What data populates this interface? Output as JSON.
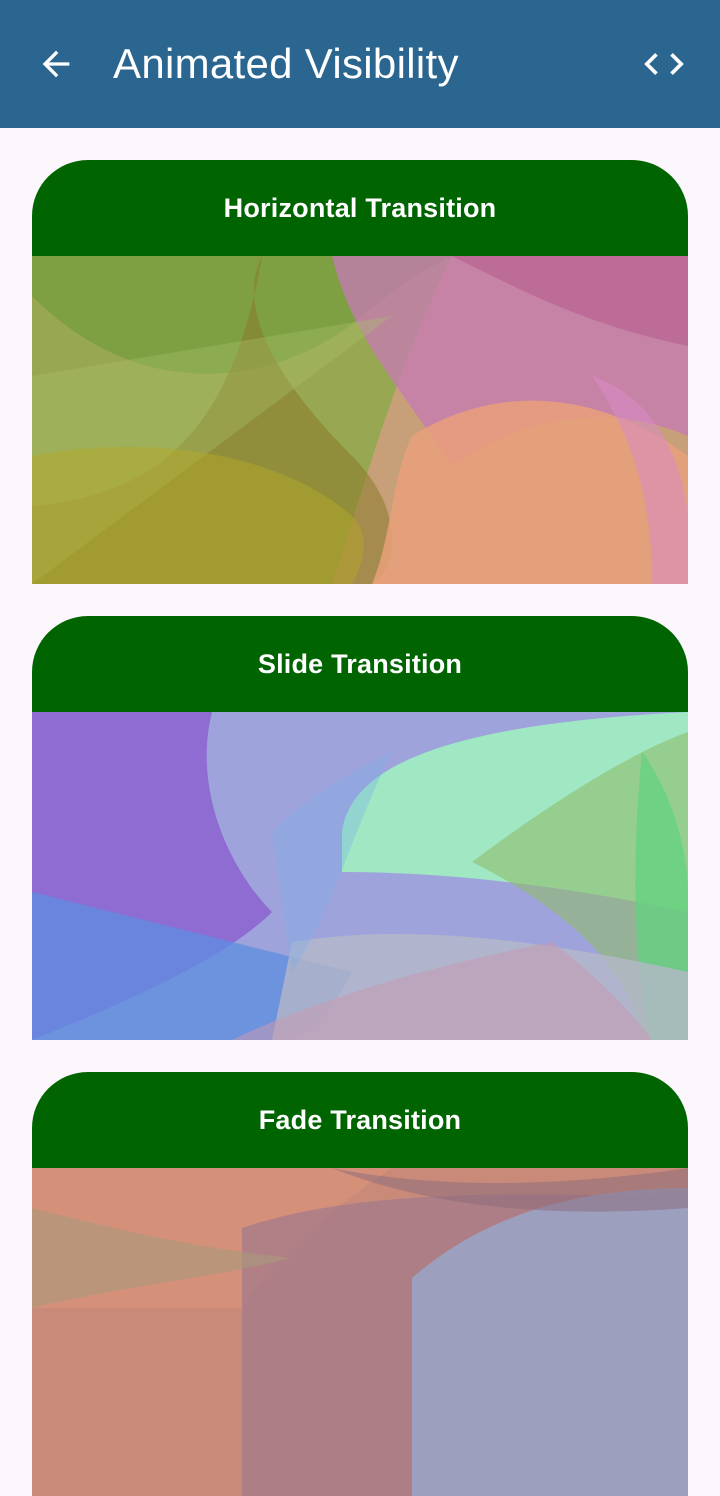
{
  "appbar": {
    "title": "Animated Visibility",
    "background": "#2a6690",
    "back_icon": "arrow-back-icon",
    "code_icon": "code-icon"
  },
  "cards": [
    {
      "title": "Horizontal Transition",
      "header_color": "#006400",
      "image": "abstract-gradient-image"
    },
    {
      "title": "Slide Transition",
      "header_color": "#006400",
      "image": "abstract-gradient-image"
    },
    {
      "title": "Fade Transition",
      "header_color": "#006400",
      "image": "abstract-gradient-image"
    }
  ]
}
